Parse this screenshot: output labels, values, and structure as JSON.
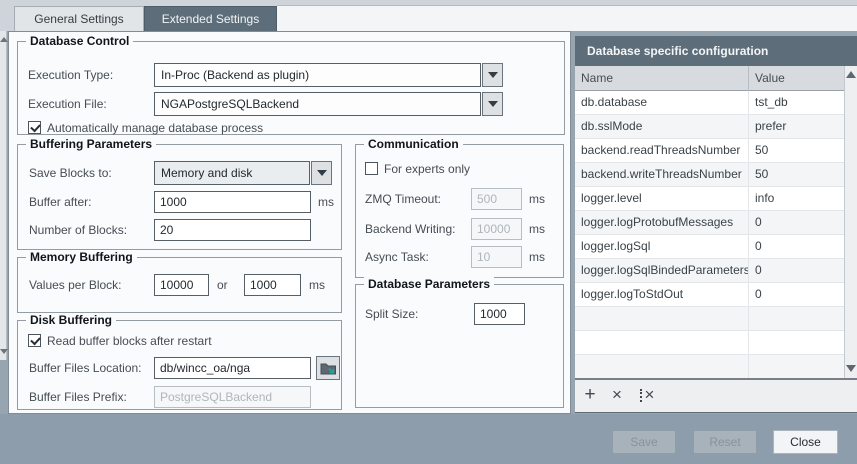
{
  "tabs": [
    {
      "label": "General Settings",
      "active": true
    },
    {
      "label": "Extended Settings",
      "active": false
    }
  ],
  "groups": {
    "database_control": {
      "title": "Database Control",
      "execution_type_label": "Execution Type:",
      "execution_type_value": "In-Proc (Backend as plugin)",
      "execution_file_label": "Execution File:",
      "execution_file_value": "NGAPostgreSQLBackend",
      "auto_manage_label": "Automatically manage database process",
      "auto_manage_checked": true
    },
    "buffering_parameters": {
      "title": "Buffering Parameters",
      "save_blocks_label": "Save Blocks to:",
      "save_blocks_value": "Memory and disk",
      "buffer_after_label": "Buffer after:",
      "buffer_after_value": "1000",
      "buffer_after_unit": "ms",
      "number_of_blocks_label": "Number of Blocks:",
      "number_of_blocks_value": "20"
    },
    "memory_buffering": {
      "title": "Memory Buffering",
      "values_per_block_label": "Values per Block:",
      "values_per_block_value": "10000",
      "or_label": "or",
      "interval_value": "1000",
      "interval_unit": "ms"
    },
    "disk_buffering": {
      "title": "Disk Buffering",
      "read_buffer_label": "Read buffer blocks after restart",
      "read_buffer_checked": true,
      "location_label": "Buffer Files Location:",
      "location_value": "db/wincc_oa/nga",
      "prefix_label": "Buffer Files Prefix:",
      "prefix_value": "PostgreSQLBackend"
    },
    "communication": {
      "title": "Communication",
      "experts_label": "For experts only",
      "experts_checked": false,
      "zmq_label": "ZMQ Timeout:",
      "zmq_value": "500",
      "zmq_unit": "ms",
      "backend_writing_label": "Backend Writing:",
      "backend_writing_value": "10000",
      "backend_writing_unit": "ms",
      "async_label": "Async Task:",
      "async_value": "10",
      "async_unit": "ms"
    },
    "database_parameters": {
      "title": "Database Parameters",
      "split_label": "Split Size:",
      "split_value": "1000"
    }
  },
  "config_panel": {
    "title": "Database specific configuration",
    "columns": [
      "Name",
      "Value"
    ],
    "rows": [
      {
        "name": "db.database",
        "value": "tst_db"
      },
      {
        "name": "db.sslMode",
        "value": "prefer"
      },
      {
        "name": "backend.readThreadsNumber",
        "value": "50"
      },
      {
        "name": "backend.writeThreadsNumber",
        "value": "50"
      },
      {
        "name": "logger.level",
        "value": "info"
      },
      {
        "name": "logger.logProtobufMessages",
        "value": "0"
      },
      {
        "name": "logger.logSql",
        "value": "0"
      },
      {
        "name": "logger.logSqlBindedParameters",
        "value": "0"
      },
      {
        "name": "logger.logToStdOut",
        "value": "0"
      }
    ],
    "empty_row_count": 4,
    "toolbar": {
      "add_icon": "+",
      "delete_icon": "×",
      "delete_all_icon": "×"
    }
  },
  "footer": {
    "save_label": "Save",
    "reset_label": "Reset",
    "close_label": "Close"
  },
  "colors": {
    "header_dark": "#5d6d79",
    "frame_background": "#8d9dab",
    "accent_teal": "#1fa59c",
    "row_stripe": "#f3f5f7"
  }
}
